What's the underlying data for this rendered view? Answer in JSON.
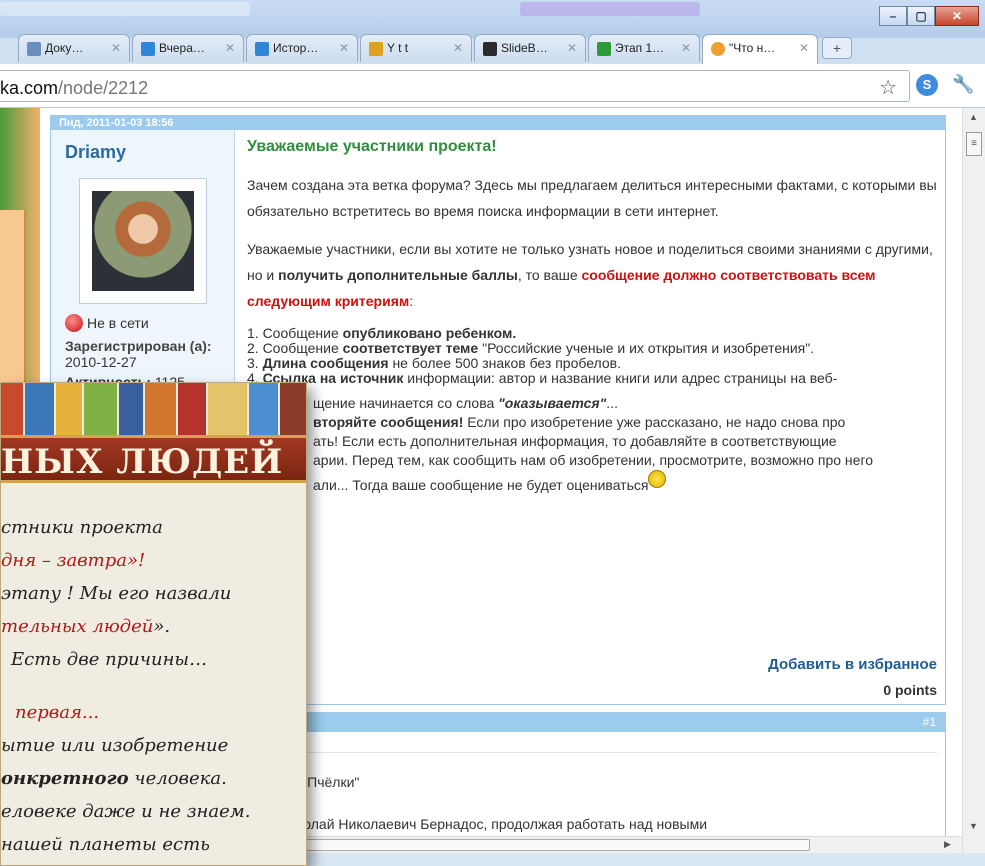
{
  "window": {
    "minimize": "–",
    "maximize": "▢",
    "close": "✕"
  },
  "tabs": [
    {
      "label": "Доку…",
      "icon": "document-icon",
      "color": "#6a8fbf"
    },
    {
      "label": "Вчера…",
      "icon": "folder-icon",
      "color": "#2f86d8"
    },
    {
      "label": "Истор…",
      "icon": "folder-icon",
      "color": "#2f86d8"
    },
    {
      "label": "Y t t",
      "icon": "tool-icon",
      "color": "#e0a020"
    },
    {
      "label": "SlideB…",
      "icon": "slideboom-icon",
      "color": "#2b2b2b"
    },
    {
      "label": "Этап 1…",
      "icon": "sheet-icon",
      "color": "#2e9a3a"
    },
    {
      "label": "\"Что н…",
      "icon": "user-icon",
      "color": "#f0a030"
    }
  ],
  "tab_close": "✕",
  "new_tab": "+",
  "toolbar": {
    "url_host": "ka.com",
    "url_path": "/node/2212",
    "bookmark": "☆",
    "ext": "S",
    "wrench": "🔧"
  },
  "post": {
    "date": "Пнд, 2011-01-03 18:56",
    "author": "Driamy",
    "status": "Не в сети",
    "reg_label": "Зарегистрирован (а):",
    "reg_date": "2010-12-27",
    "activity_label": "Активность:",
    "activity_value": "1125",
    "title": "Уважаемые участники проекта!",
    "p1": "Зачем создана эта ветка форума? Здесь мы предлагаем делиться интересными фактами, с которыми вы обязательно встретитесь во время поиска информации в сети интернет.",
    "p2a": "Уважаемые участники, если вы хотите не только узнать новое и поделиться своими знаниями с другими, но и ",
    "p2b": "получить дополнительные баллы",
    "p2c": ", то ваше ",
    "p2d": "сообщение должно соответствовать всем следующим критериям",
    "p2e": ":",
    "l1a": "1. Сообщение ",
    "l1b": "опубликовано ребенком.",
    "l2a": "2. Сообщение ",
    "l2b": "соответствует теме",
    "l2c": " \"Российские ученые и их открытия и изобретения\".",
    "l3a": "3. ",
    "l3b": "Длина сообщения",
    "l3c": " не более 500 знаков без пробелов.",
    "l4a": "4. ",
    "l4b": "Ссылка на источник",
    "l4c": " информации: автор и название книги или адрес страницы на веб-",
    "l5a": "щение начинается со слова ",
    "l5b": "\"оказывается\"",
    "l5c": "...",
    "l6a": "вторяйте сообщения!",
    "l6b": " Если про изобретение уже рассказано, не надо снова про",
    "l7": "ать! Если есть дополнительная информация, то добавляйте в соответствующие",
    "l8": "арии. Перед тем, как сообщить нам об изобретении, просмотрите, возможно про него",
    "l9": "али... Тогда ваше сообщение не будет оцениваться",
    "favorite": "Добавить в избранное",
    "points": "0 points"
  },
  "reply": {
    "number": "#1",
    "team": "команда\"Пчёлки\"",
    "text": "ется Николай Николаевич Бернадос, продолжая работать над новыми"
  },
  "slide": {
    "banner": "НЫХ ЛЮДЕЙ",
    "line1": "стники проекта",
    "line2": "дня – завтра»!",
    "line3": "этапу ! Мы его назвали",
    "line4": "тельных людей",
    "line4b": "».",
    "line5": "Есть две причины…",
    "line6": "первая...",
    "line7": "ытие  или изобретение",
    "line8a": "онкретного",
    "line8b": " человека.",
    "line9": "еловеке даже и не знаем.",
    "line10": "нашей планеты есть"
  }
}
